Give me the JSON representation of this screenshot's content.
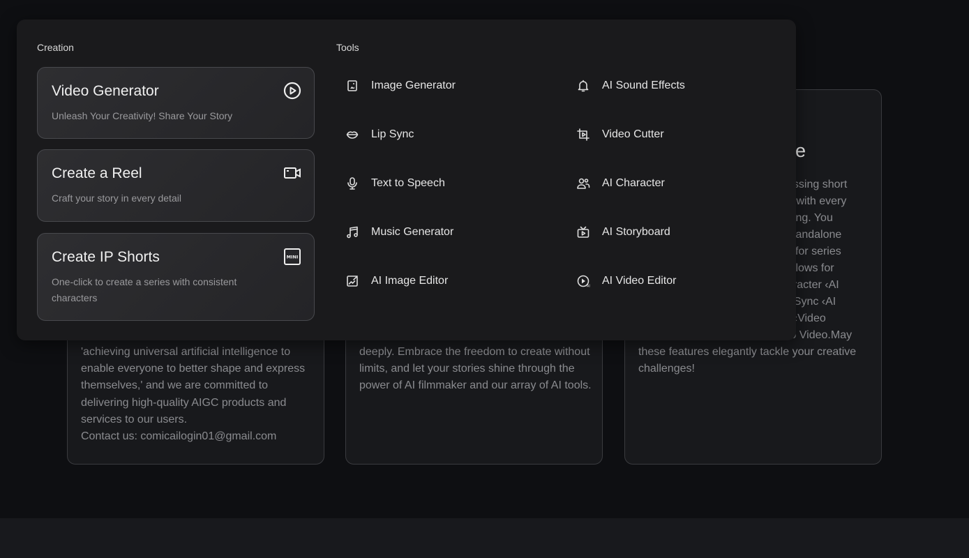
{
  "background": {
    "cards": [
      {
        "lines": [
          "'achieving universal artificial intelligence to enable everyone to better shape and express themselves,' and we are committed to delivering high-quality AIGC products and services to our users.",
          "Contact us: comicailogin01@gmail.com"
        ]
      },
      {
        "lines": [
          "deeply. Embrace the freedom to create without limits, and let your stories shine through the power of AI filmmaker and our array of AI tools."
        ]
      },
      {
        "title_fragment": "e",
        "fragments": [
          "assing short",
          "d with every",
          "fting. You",
          "standalone",
          ":' for series",
          "allows for",
          "aracter ‹AI",
          "› Sync ‹AI",
          "r ‹Video",
          "to Video.May"
        ],
        "lines": [
          "these features elegantly tackle your creative challenges!"
        ]
      }
    ]
  },
  "menu": {
    "creation_label": "Creation",
    "tools_label": "Tools",
    "creation": [
      {
        "title": "Video Generator",
        "desc": "Unleash Your Creativity! Share Your Story",
        "icon": "play-circle-icon"
      },
      {
        "title": "Create a Reel",
        "desc": "Craft your story in every detail",
        "icon": "video-camera-icon"
      },
      {
        "title": "Create IP Shorts",
        "desc": "One-click to create a series with consistent characters",
        "icon": "mini-badge-icon",
        "icon_text": "MINI"
      }
    ],
    "tools": [
      {
        "label": "Image Generator",
        "icon": "image-icon"
      },
      {
        "label": "AI Sound Effects",
        "icon": "bell-icon"
      },
      {
        "label": "Lip Sync",
        "icon": "lips-icon"
      },
      {
        "label": "Video Cutter",
        "icon": "crop-video-icon"
      },
      {
        "label": "Text to Speech",
        "icon": "microphone-icon"
      },
      {
        "label": "AI Character",
        "icon": "users-icon"
      },
      {
        "label": "Music Generator",
        "icon": "music-note-icon"
      },
      {
        "label": "AI Storyboard",
        "icon": "tv-play-icon"
      },
      {
        "label": "AI Image Editor",
        "icon": "image-edit-icon"
      },
      {
        "label": "AI Video Editor",
        "icon": "ai-video-icon"
      }
    ]
  }
}
